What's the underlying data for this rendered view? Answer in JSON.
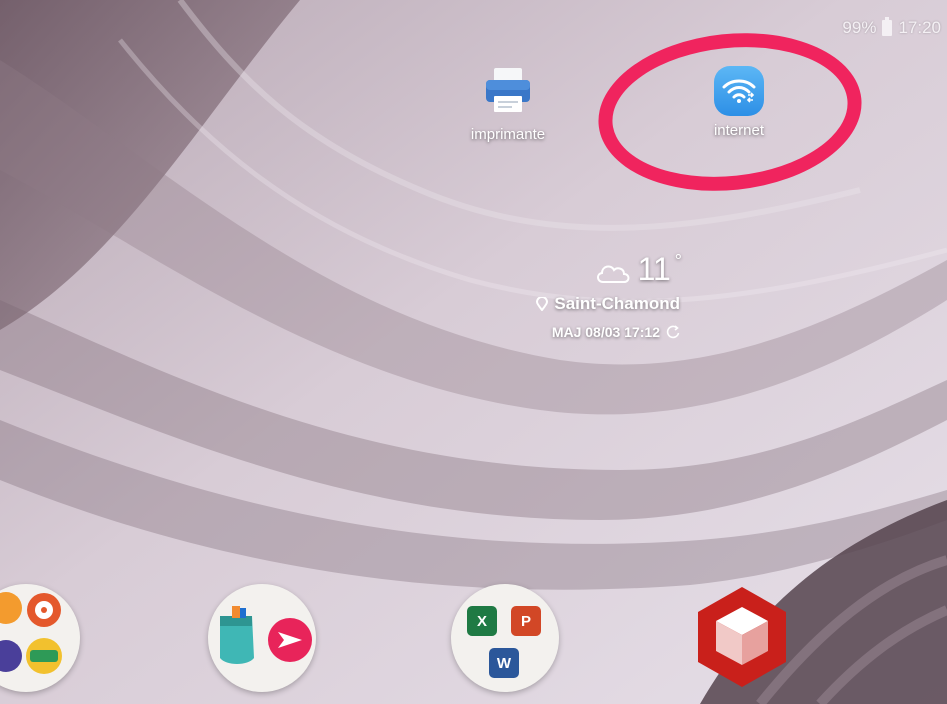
{
  "status_bar": {
    "battery": "99%",
    "time": "17:20"
  },
  "home": {
    "apps": [
      {
        "label": "imprimante",
        "icon": "printer-icon"
      },
      {
        "label": "internet",
        "icon": "wifi-icon"
      }
    ],
    "weather": {
      "temperature": "11",
      "degree": "°",
      "location": "Saint-Chamond",
      "updated": "MAJ 08/03 17:12"
    }
  },
  "dock": {
    "folders": [
      {
        "icon": "app-folder-icon"
      },
      {
        "icon": "app-folder-icon"
      },
      {
        "icon": "office-folder-icon",
        "apps": [
          "Excel",
          "PowerPoint",
          "Word"
        ]
      }
    ],
    "apps": [
      {
        "icon": "cube-app-icon"
      }
    ]
  },
  "colors": {
    "highlight": "#f0245e",
    "wifi_tile": "#3ea3ef",
    "excel": "#1f7a44",
    "powerpoint": "#d24726",
    "word": "#2b579a"
  }
}
